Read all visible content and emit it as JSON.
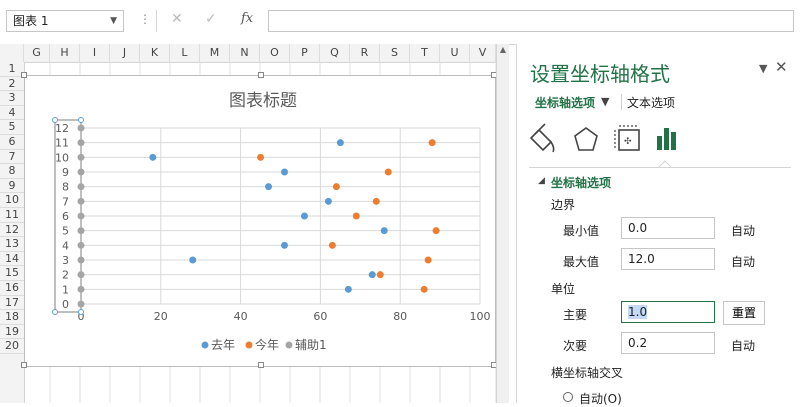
{
  "formula_bar": {
    "name_box": "图表 1",
    "separator": "⋮",
    "cancel_glyph": "✕",
    "enter_glyph": "✓",
    "fx_label": "fx",
    "formula": ""
  },
  "columns": [
    "G",
    "H",
    "I",
    "J",
    "K",
    "L",
    "M",
    "N",
    "O",
    "P",
    "Q",
    "R",
    "S",
    "T",
    "U",
    "V"
  ],
  "rows": [
    "1",
    "2",
    "3",
    "4",
    "5",
    "6",
    "7",
    "8",
    "9",
    "10",
    "11",
    "12",
    "13",
    "14",
    "15",
    "16",
    "17",
    "18",
    "19",
    "20"
  ],
  "chart": {
    "title": "图表标题",
    "colors": {
      "series1": "#5b9bd5",
      "series2": "#ed7d31",
      "series3": "#a5a5a5"
    },
    "legend": [
      "去年",
      "今年",
      "辅助1"
    ]
  },
  "chart_data": {
    "type": "scatter",
    "title": "图表标题",
    "xlabel": "",
    "ylabel": "",
    "xlim": [
      0,
      100
    ],
    "ylim": [
      0,
      12
    ],
    "x_ticks": [
      0,
      20,
      40,
      60,
      80,
      100
    ],
    "y_ticks": [
      0,
      1,
      2,
      3,
      4,
      5,
      6,
      7,
      8,
      9,
      10,
      11,
      12
    ],
    "grid": true,
    "legend_position": "bottom",
    "series": [
      {
        "name": "去年",
        "points": [
          [
            65,
            11
          ],
          [
            18,
            10
          ],
          [
            51,
            9
          ],
          [
            47,
            8
          ],
          [
            62,
            7
          ],
          [
            56,
            6
          ],
          [
            76,
            5
          ],
          [
            51,
            4
          ],
          [
            28,
            3
          ],
          [
            73,
            2
          ],
          [
            67,
            1
          ]
        ]
      },
      {
        "name": "今年",
        "points": [
          [
            88,
            11
          ],
          [
            45,
            10
          ],
          [
            77,
            9
          ],
          [
            64,
            8
          ],
          [
            74,
            7
          ],
          [
            69,
            6
          ],
          [
            89,
            5
          ],
          [
            63,
            4
          ],
          [
            87,
            3
          ],
          [
            75,
            2
          ],
          [
            86,
            1
          ]
        ]
      },
      {
        "name": "辅助1",
        "points": [
          [
            0,
            12
          ],
          [
            0,
            11
          ],
          [
            0,
            10
          ],
          [
            0,
            9
          ],
          [
            0,
            8
          ],
          [
            0,
            7
          ],
          [
            0,
            6
          ],
          [
            0,
            5
          ],
          [
            0,
            4
          ],
          [
            0,
            3
          ],
          [
            0,
            2
          ],
          [
            0,
            1
          ],
          [
            0,
            0
          ]
        ]
      }
    ]
  },
  "pane": {
    "title": "设置坐标轴格式",
    "tab_axis": "坐标轴选项",
    "tab_text": "文本选项",
    "section": "坐标轴选项",
    "bounds_label": "边界",
    "min_label": "最小值",
    "min_value": "0.0",
    "max_label": "最大值",
    "max_value": "12.0",
    "auto": "自动",
    "units_label": "单位",
    "major_label": "主要",
    "major_value": "1.0",
    "reset": "重置",
    "minor_label": "次要",
    "minor_value": "0.2",
    "cross_label": "横坐标轴交叉",
    "auto_option": "自动(O)"
  }
}
